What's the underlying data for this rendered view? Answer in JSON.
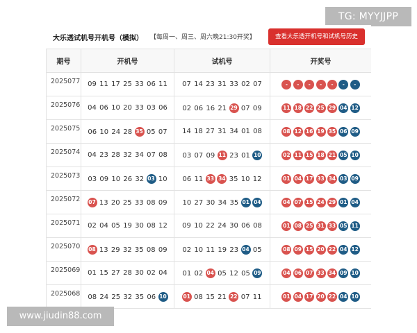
{
  "watermark_top": "TG: MYYJJPP",
  "watermark_bottom": "www.jiudin88.com",
  "header": {
    "title": "大乐透试机号开机号（模拟）",
    "schedule": "【每周一、周三、周六晚21:30开奖】",
    "history_button": "查看大乐透开机号和试机号历史"
  },
  "columns": [
    "期号",
    "开机号",
    "试机号",
    "开奖号"
  ],
  "colors": {
    "red_ball": "#d9534f",
    "blue_ball": "#1f5c86",
    "button": "#d9302d"
  },
  "rows": [
    {
      "issue": "2025077",
      "open": [
        {
          "v": "09",
          "c": ""
        },
        {
          "v": "11",
          "c": ""
        },
        {
          "v": "17",
          "c": ""
        },
        {
          "v": "25",
          "c": ""
        },
        {
          "v": "33",
          "c": ""
        },
        {
          "v": "06",
          "c": ""
        },
        {
          "v": "11",
          "c": ""
        }
      ],
      "trial": [
        {
          "v": "07",
          "c": ""
        },
        {
          "v": "14",
          "c": ""
        },
        {
          "v": "23",
          "c": ""
        },
        {
          "v": "31",
          "c": ""
        },
        {
          "v": "33",
          "c": ""
        },
        {
          "v": "02",
          "c": ""
        },
        {
          "v": "07",
          "c": ""
        }
      ],
      "prize": [
        {
          "v": "-",
          "c": "red"
        },
        {
          "v": "-",
          "c": "red"
        },
        {
          "v": "-",
          "c": "red"
        },
        {
          "v": "-",
          "c": "red"
        },
        {
          "v": "-",
          "c": "red"
        },
        {
          "v": "-",
          "c": "blue"
        },
        {
          "v": "-",
          "c": "blue"
        }
      ]
    },
    {
      "issue": "2025076",
      "open": [
        {
          "v": "04",
          "c": ""
        },
        {
          "v": "06",
          "c": ""
        },
        {
          "v": "10",
          "c": ""
        },
        {
          "v": "20",
          "c": ""
        },
        {
          "v": "33",
          "c": ""
        },
        {
          "v": "03",
          "c": ""
        },
        {
          "v": "06",
          "c": ""
        }
      ],
      "trial": [
        {
          "v": "02",
          "c": ""
        },
        {
          "v": "06",
          "c": ""
        },
        {
          "v": "16",
          "c": ""
        },
        {
          "v": "21",
          "c": ""
        },
        {
          "v": "29",
          "c": "red"
        },
        {
          "v": "07",
          "c": ""
        },
        {
          "v": "09",
          "c": ""
        }
      ],
      "prize": [
        {
          "v": "11",
          "c": "red"
        },
        {
          "v": "18",
          "c": "red"
        },
        {
          "v": "22",
          "c": "red"
        },
        {
          "v": "25",
          "c": "red"
        },
        {
          "v": "29",
          "c": "red"
        },
        {
          "v": "04",
          "c": "blue"
        },
        {
          "v": "12",
          "c": "blue"
        }
      ]
    },
    {
      "issue": "2025075",
      "open": [
        {
          "v": "06",
          "c": ""
        },
        {
          "v": "10",
          "c": ""
        },
        {
          "v": "24",
          "c": ""
        },
        {
          "v": "28",
          "c": ""
        },
        {
          "v": "35",
          "c": "red"
        },
        {
          "v": "05",
          "c": ""
        },
        {
          "v": "07",
          "c": ""
        }
      ],
      "trial": [
        {
          "v": "14",
          "c": ""
        },
        {
          "v": "18",
          "c": ""
        },
        {
          "v": "27",
          "c": ""
        },
        {
          "v": "31",
          "c": ""
        },
        {
          "v": "34",
          "c": ""
        },
        {
          "v": "01",
          "c": ""
        },
        {
          "v": "08",
          "c": ""
        }
      ],
      "prize": [
        {
          "v": "08",
          "c": "red"
        },
        {
          "v": "12",
          "c": "red"
        },
        {
          "v": "16",
          "c": "red"
        },
        {
          "v": "19",
          "c": "red"
        },
        {
          "v": "35",
          "c": "red"
        },
        {
          "v": "06",
          "c": "blue"
        },
        {
          "v": "09",
          "c": "blue"
        }
      ]
    },
    {
      "issue": "2025074",
      "open": [
        {
          "v": "04",
          "c": ""
        },
        {
          "v": "23",
          "c": ""
        },
        {
          "v": "28",
          "c": ""
        },
        {
          "v": "32",
          "c": ""
        },
        {
          "v": "34",
          "c": ""
        },
        {
          "v": "07",
          "c": ""
        },
        {
          "v": "08",
          "c": ""
        }
      ],
      "trial": [
        {
          "v": "03",
          "c": ""
        },
        {
          "v": "07",
          "c": ""
        },
        {
          "v": "09",
          "c": ""
        },
        {
          "v": "11",
          "c": "red"
        },
        {
          "v": "23",
          "c": ""
        },
        {
          "v": "01",
          "c": ""
        },
        {
          "v": "10",
          "c": "blue"
        }
      ],
      "prize": [
        {
          "v": "02",
          "c": "red"
        },
        {
          "v": "11",
          "c": "red"
        },
        {
          "v": "15",
          "c": "red"
        },
        {
          "v": "18",
          "c": "red"
        },
        {
          "v": "21",
          "c": "red"
        },
        {
          "v": "05",
          "c": "blue"
        },
        {
          "v": "10",
          "c": "blue"
        }
      ]
    },
    {
      "issue": "2025073",
      "open": [
        {
          "v": "03",
          "c": ""
        },
        {
          "v": "09",
          "c": ""
        },
        {
          "v": "10",
          "c": ""
        },
        {
          "v": "26",
          "c": ""
        },
        {
          "v": "32",
          "c": ""
        },
        {
          "v": "03",
          "c": "blue"
        },
        {
          "v": "10",
          "c": ""
        }
      ],
      "trial": [
        {
          "v": "06",
          "c": ""
        },
        {
          "v": "11",
          "c": ""
        },
        {
          "v": "33",
          "c": "red"
        },
        {
          "v": "34",
          "c": "red"
        },
        {
          "v": "35",
          "c": ""
        },
        {
          "v": "10",
          "c": ""
        },
        {
          "v": "12",
          "c": ""
        }
      ],
      "prize": [
        {
          "v": "01",
          "c": "red"
        },
        {
          "v": "04",
          "c": "red"
        },
        {
          "v": "17",
          "c": "red"
        },
        {
          "v": "33",
          "c": "red"
        },
        {
          "v": "34",
          "c": "red"
        },
        {
          "v": "03",
          "c": "blue"
        },
        {
          "v": "09",
          "c": "blue"
        }
      ]
    },
    {
      "issue": "2025072",
      "open": [
        {
          "v": "07",
          "c": "red"
        },
        {
          "v": "13",
          "c": ""
        },
        {
          "v": "20",
          "c": ""
        },
        {
          "v": "25",
          "c": ""
        },
        {
          "v": "33",
          "c": ""
        },
        {
          "v": "08",
          "c": ""
        },
        {
          "v": "09",
          "c": ""
        }
      ],
      "trial": [
        {
          "v": "10",
          "c": ""
        },
        {
          "v": "27",
          "c": ""
        },
        {
          "v": "30",
          "c": ""
        },
        {
          "v": "34",
          "c": ""
        },
        {
          "v": "35",
          "c": ""
        },
        {
          "v": "01",
          "c": "blue"
        },
        {
          "v": "04",
          "c": "blue"
        }
      ],
      "prize": [
        {
          "v": "04",
          "c": "red"
        },
        {
          "v": "07",
          "c": "red"
        },
        {
          "v": "15",
          "c": "red"
        },
        {
          "v": "24",
          "c": "red"
        },
        {
          "v": "29",
          "c": "red"
        },
        {
          "v": "01",
          "c": "blue"
        },
        {
          "v": "04",
          "c": "blue"
        }
      ]
    },
    {
      "issue": "2025071",
      "open": [
        {
          "v": "02",
          "c": ""
        },
        {
          "v": "04",
          "c": ""
        },
        {
          "v": "05",
          "c": ""
        },
        {
          "v": "19",
          "c": ""
        },
        {
          "v": "30",
          "c": ""
        },
        {
          "v": "08",
          "c": ""
        },
        {
          "v": "12",
          "c": ""
        }
      ],
      "trial": [
        {
          "v": "09",
          "c": ""
        },
        {
          "v": "10",
          "c": ""
        },
        {
          "v": "22",
          "c": ""
        },
        {
          "v": "24",
          "c": ""
        },
        {
          "v": "30",
          "c": ""
        },
        {
          "v": "06",
          "c": ""
        },
        {
          "v": "08",
          "c": ""
        }
      ],
      "prize": [
        {
          "v": "01",
          "c": "red"
        },
        {
          "v": "08",
          "c": "red"
        },
        {
          "v": "25",
          "c": "red"
        },
        {
          "v": "31",
          "c": "red"
        },
        {
          "v": "33",
          "c": "red"
        },
        {
          "v": "05",
          "c": "blue"
        },
        {
          "v": "11",
          "c": "blue"
        }
      ]
    },
    {
      "issue": "2025070",
      "open": [
        {
          "v": "08",
          "c": "red"
        },
        {
          "v": "13",
          "c": ""
        },
        {
          "v": "29",
          "c": ""
        },
        {
          "v": "32",
          "c": ""
        },
        {
          "v": "35",
          "c": ""
        },
        {
          "v": "08",
          "c": ""
        },
        {
          "v": "09",
          "c": ""
        }
      ],
      "trial": [
        {
          "v": "02",
          "c": ""
        },
        {
          "v": "10",
          "c": ""
        },
        {
          "v": "11",
          "c": ""
        },
        {
          "v": "19",
          "c": ""
        },
        {
          "v": "23",
          "c": ""
        },
        {
          "v": "04",
          "c": "blue"
        },
        {
          "v": "05",
          "c": ""
        }
      ],
      "prize": [
        {
          "v": "08",
          "c": "red"
        },
        {
          "v": "09",
          "c": "red"
        },
        {
          "v": "15",
          "c": "red"
        },
        {
          "v": "20",
          "c": "red"
        },
        {
          "v": "22",
          "c": "red"
        },
        {
          "v": "04",
          "c": "blue"
        },
        {
          "v": "12",
          "c": "blue"
        }
      ]
    },
    {
      "issue": "2025069",
      "open": [
        {
          "v": "01",
          "c": ""
        },
        {
          "v": "15",
          "c": ""
        },
        {
          "v": "27",
          "c": ""
        },
        {
          "v": "28",
          "c": ""
        },
        {
          "v": "30",
          "c": ""
        },
        {
          "v": "02",
          "c": ""
        },
        {
          "v": "04",
          "c": ""
        }
      ],
      "trial": [
        {
          "v": "01",
          "c": ""
        },
        {
          "v": "02",
          "c": ""
        },
        {
          "v": "04",
          "c": "red"
        },
        {
          "v": "05",
          "c": ""
        },
        {
          "v": "12",
          "c": ""
        },
        {
          "v": "05",
          "c": ""
        },
        {
          "v": "09",
          "c": "blue"
        }
      ],
      "prize": [
        {
          "v": "04",
          "c": "red"
        },
        {
          "v": "06",
          "c": "red"
        },
        {
          "v": "07",
          "c": "red"
        },
        {
          "v": "33",
          "c": "red"
        },
        {
          "v": "34",
          "c": "red"
        },
        {
          "v": "09",
          "c": "blue"
        },
        {
          "v": "10",
          "c": "blue"
        }
      ]
    },
    {
      "issue": "2025068",
      "open": [
        {
          "v": "08",
          "c": ""
        },
        {
          "v": "24",
          "c": ""
        },
        {
          "v": "25",
          "c": ""
        },
        {
          "v": "32",
          "c": ""
        },
        {
          "v": "35",
          "c": ""
        },
        {
          "v": "06",
          "c": ""
        },
        {
          "v": "10",
          "c": "blue"
        }
      ],
      "trial": [
        {
          "v": "01",
          "c": "red"
        },
        {
          "v": "08",
          "c": ""
        },
        {
          "v": "15",
          "c": ""
        },
        {
          "v": "21",
          "c": ""
        },
        {
          "v": "22",
          "c": "red"
        },
        {
          "v": "07",
          "c": ""
        },
        {
          "v": "11",
          "c": ""
        }
      ],
      "prize": [
        {
          "v": "01",
          "c": "red"
        },
        {
          "v": "04",
          "c": "red"
        },
        {
          "v": "17",
          "c": "red"
        },
        {
          "v": "20",
          "c": "red"
        },
        {
          "v": "22",
          "c": "red"
        },
        {
          "v": "04",
          "c": "blue"
        },
        {
          "v": "10",
          "c": "blue"
        }
      ]
    }
  ]
}
